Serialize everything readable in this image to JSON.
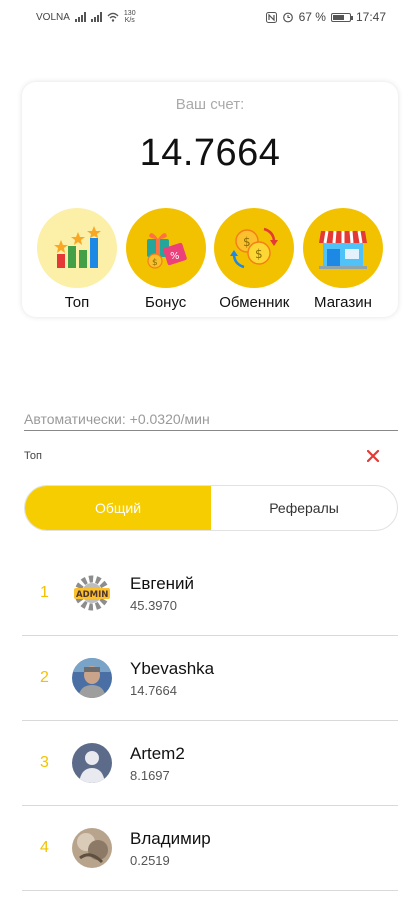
{
  "status_bar": {
    "carrier": "VOLNA",
    "net_speed_value": "130",
    "net_speed_unit": "K/s",
    "battery_percent": "67 %",
    "battery_level": 0.67,
    "time": "17:47"
  },
  "balance": {
    "label": "Ваш счет:",
    "value": "14.7664"
  },
  "actions": [
    {
      "label": "Топ",
      "icon": "bar-chart-icon"
    },
    {
      "label": "Бонус",
      "icon": "gift-icon"
    },
    {
      "label": "Обменник",
      "icon": "coin-exchange-icon"
    },
    {
      "label": "Магазин",
      "icon": "store-icon"
    }
  ],
  "auto_income": "Автоматически: +0.0320/мин",
  "top_section": {
    "title": "Топ",
    "close_icon": "close-icon",
    "tabs": [
      {
        "label": "Общий",
        "active": true
      },
      {
        "label": "Рефералы",
        "active": false
      }
    ]
  },
  "leaderboard": [
    {
      "rank": "1",
      "name": "Евгений",
      "score": "45.3970",
      "avatar": "admin-gear-icon"
    },
    {
      "rank": "2",
      "name": "Ybevashka",
      "score": "14.7664",
      "avatar": "photo-avatar"
    },
    {
      "rank": "3",
      "name": "Artem2",
      "score": "8.1697",
      "avatar": "default-user-avatar"
    },
    {
      "rank": "4",
      "name": "Владимир",
      "score": "0.2519",
      "avatar": "photo-avatar"
    }
  ],
  "colors": {
    "accent": "#f5cd00",
    "rank": "#f2c200",
    "close": "#e53935"
  }
}
